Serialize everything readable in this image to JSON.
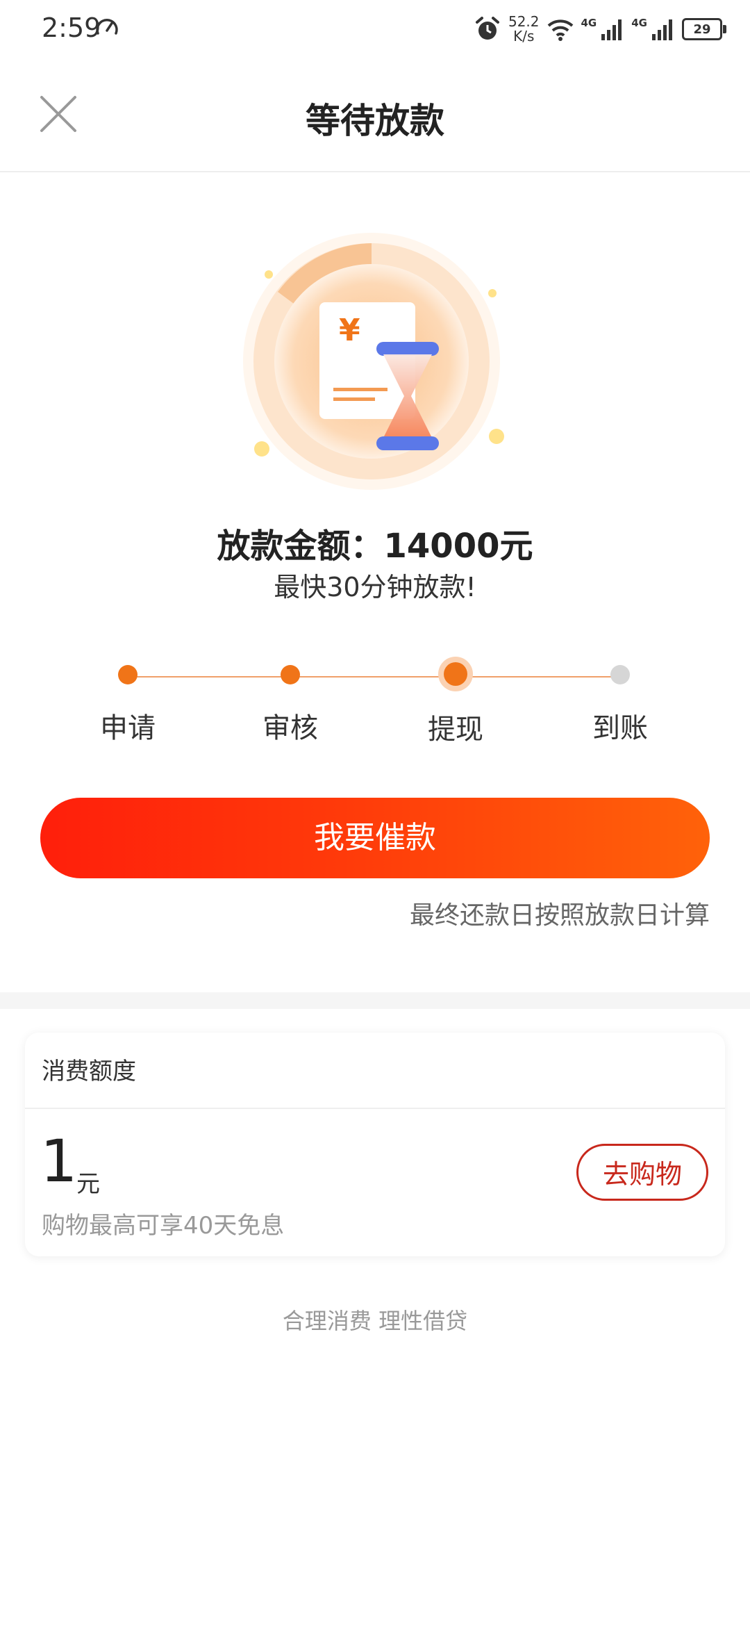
{
  "status_bar": {
    "time": "2:59",
    "speed_value": "52.2",
    "speed_unit": "K/s",
    "net_type_1": "4G",
    "net_type_2": "4G",
    "battery": "29"
  },
  "header": {
    "title": "等待放款"
  },
  "loan": {
    "amount_text": "放款金额：14000元",
    "eta_text": "最快30分钟放款!"
  },
  "steps": [
    {
      "label": "申请",
      "state": "done"
    },
    {
      "label": "审核",
      "state": "done"
    },
    {
      "label": "提现",
      "state": "current"
    },
    {
      "label": "到账",
      "state": "pending"
    }
  ],
  "actions": {
    "urge_label": "我要催款",
    "repay_note": "最终还款日按照放款日计算"
  },
  "credit": {
    "title": "消费额度",
    "value": "1",
    "unit": "元",
    "note": "购物最高可享40天免息",
    "shop_label": "去购物"
  },
  "footer": {
    "slogan": "合理消费 理性借贷"
  },
  "colors": {
    "accent": "#f07418",
    "button_start": "#ff1f0b",
    "button_end": "#ff620a",
    "shop_border": "#c8281c"
  }
}
